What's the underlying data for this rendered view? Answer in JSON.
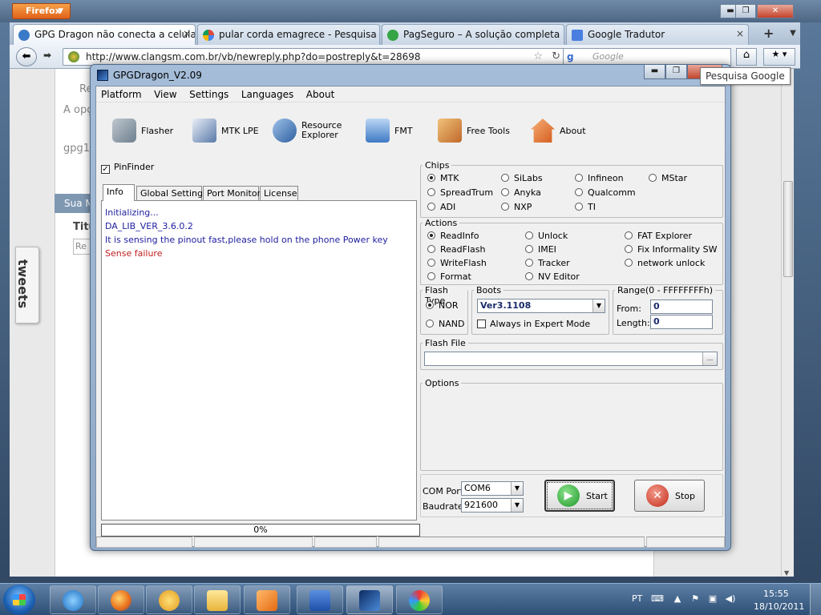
{
  "firefox": {
    "menu_label": "Firefox",
    "tabs": [
      {
        "label": "GPG Dragon não conecta a celula...",
        "close": "×",
        "icon_color": "#3a7ac8"
      },
      {
        "label": "pular corda emagrece - Pesquisa ...",
        "close": "",
        "icon_color": "#dd4b39"
      },
      {
        "label": "PagSeguro – A solução completa ...",
        "close": "",
        "icon_color": "#35a545"
      },
      {
        "label": "Google Tradutor",
        "close": "×",
        "icon_color": "#4a7fe0"
      }
    ],
    "new_tab": "+",
    "url": "http://www.clangsm.com.br/vb/newreply.php?do=postreply&t=28698",
    "search_placeholder": "Google",
    "tooltip": "Pesquisa Google"
  },
  "page": {
    "text_1": "Re",
    "text_2": "A opç",
    "text_3": "gpg1",
    "sua_bar": "Sua M",
    "titulo": "Titu",
    "input_stub": "Re",
    "tweets": "tweets"
  },
  "gpg": {
    "title": "GPGDragon_V2.09",
    "menu": [
      "Platform",
      "View",
      "Settings",
      "Languages",
      "About"
    ],
    "toolbar": [
      {
        "label": "Flasher",
        "icon": "phone-icon",
        "color": "#6d7f8e"
      },
      {
        "label": "MTK LPE",
        "icon": "document-icon",
        "color": "#5878a8"
      },
      {
        "label_1": "Resource",
        "label_2": "Explorer",
        "icon": "film-icon",
        "color": "#2e5fa0"
      },
      {
        "label": "FMT",
        "icon": "monitor-icon",
        "color": "#3f79c4"
      },
      {
        "label": "Free Tools",
        "icon": "tools-icon",
        "color": "#c0682a"
      },
      {
        "label": "About",
        "icon": "home-icon",
        "color": "#d45a1c"
      }
    ],
    "pinfinder": {
      "label": "PinFinder",
      "checked": true
    },
    "tabs": [
      "Info",
      "Global Settings",
      "Port Monitor",
      "License"
    ],
    "log": [
      "Initializing...",
      "DA_LIB_VER_3.6.0.2",
      "It is sensing the pinout fast,please hold on the phone Power key",
      "Sense failure"
    ],
    "progress": "0%",
    "chips": {
      "label": "Chips",
      "options": [
        "MTK",
        "SiLabs",
        "Infineon",
        "MStar",
        "SpreadTrum",
        "Anyka",
        "Qualcomm",
        "ADI",
        "NXP",
        "TI"
      ],
      "selected": "MTK"
    },
    "actions": {
      "label": "Actions",
      "options": [
        "ReadInfo",
        "Unlock",
        "FAT Explorer",
        "ReadFlash",
        "IMEI",
        "Fix Informality SW",
        "WriteFlash",
        "Tracker",
        "network unlock",
        "Format",
        "NV Editor"
      ],
      "selected": "ReadInfo"
    },
    "flash_type": {
      "label": "Flash Type",
      "options": [
        "NOR",
        "NAND"
      ],
      "selected": "NOR"
    },
    "boots": {
      "label": "Boots",
      "value": "Ver3.1108",
      "expert_label": "Always in Expert Mode"
    },
    "range": {
      "label": "Range(0 - FFFFFFFFh)",
      "from_label": "From:",
      "from_value": "0",
      "length_label": "Length:",
      "length_value": "0"
    },
    "flash_file": {
      "label": "Flash File",
      "browse": "..."
    },
    "options_label": "Options",
    "com_port": {
      "label": "COM Port",
      "value": "COM6"
    },
    "baudrate": {
      "label": "Baudrate",
      "value": "921600"
    },
    "start_label": "Start",
    "stop_label": "Stop"
  },
  "taskbar": {
    "lang": "PT",
    "time": "15:55",
    "date": "18/10/2011"
  }
}
